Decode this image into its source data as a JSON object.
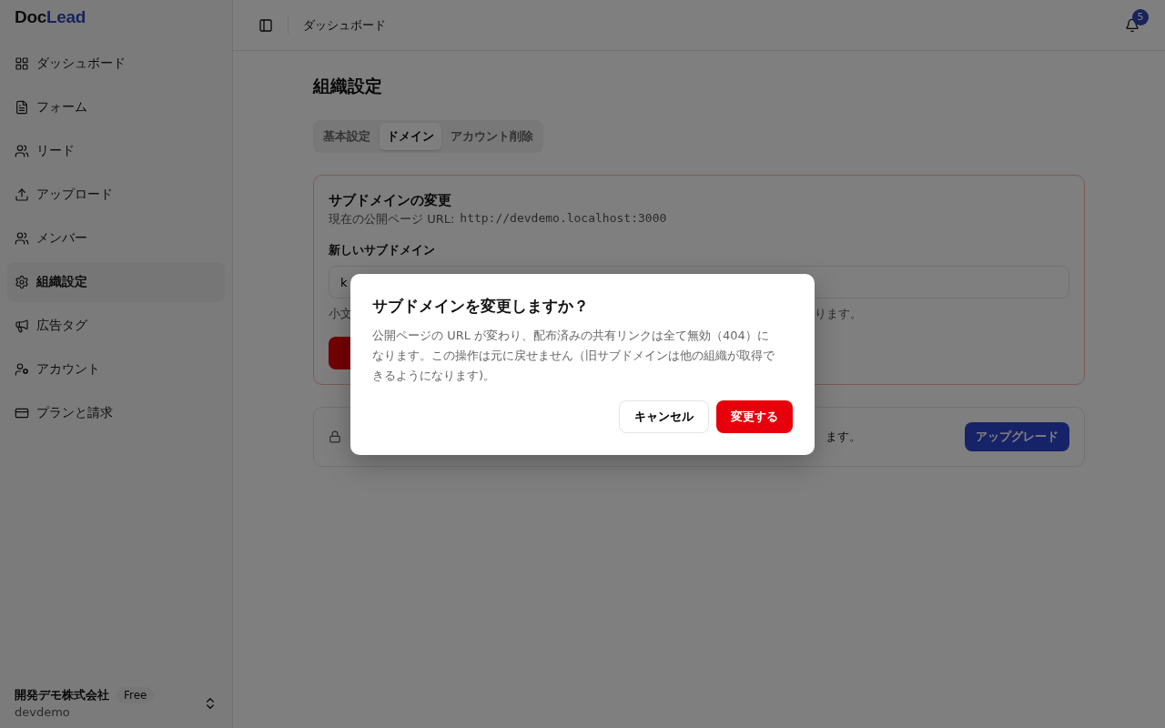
{
  "logo": {
    "part_1": "Doc",
    "part_2": "Lead"
  },
  "sidebar": {
    "items": [
      {
        "label": "ダッシュボード",
        "selected": false
      },
      {
        "label": "フォーム",
        "selected": false
      },
      {
        "label": "リード",
        "selected": false
      },
      {
        "label": "アップロード",
        "selected": false
      },
      {
        "label": "メンバー",
        "selected": false
      },
      {
        "label": "組織設定",
        "selected": true
      },
      {
        "label": "広告タグ",
        "selected": false
      },
      {
        "label": "アカウント",
        "selected": false
      },
      {
        "label": "プランと請求",
        "selected": false
      }
    ],
    "org": {
      "name": "開発デモ株式会社",
      "plan": "Free",
      "slug": "devdemo"
    }
  },
  "header": {
    "breadcrumb": "ダッシュボード",
    "notifications": "5"
  },
  "page": {
    "title": "組織設定",
    "tabs": [
      {
        "label": "基本設定",
        "selected": false
      },
      {
        "label": "ドメイン",
        "selected": true
      },
      {
        "label": "アカウント削除",
        "selected": false
      }
    ],
    "subdomain_card": {
      "title": "サブドメインの変更",
      "url_label": "現在の公開ページ URL:",
      "url": "http://devdemo.localhost:3000",
      "field_label": "新しいサブドメイン",
      "field_value": "k",
      "hint_start": "小文",
      "hint_end": "ります。"
    },
    "upgrade_card": {
      "text_end": "ます。",
      "button": "アップグレード"
    }
  },
  "dialog": {
    "title": "サブドメインを変更しますか？",
    "body": "公開ページの URL が変わり、配布済みの共有リンクは全て無効（404）になります。この操作は元に戻せません（旧サブドメインは他の組織が取得できるようになります)。",
    "cancel": "キャンセル",
    "confirm": "変更する"
  }
}
